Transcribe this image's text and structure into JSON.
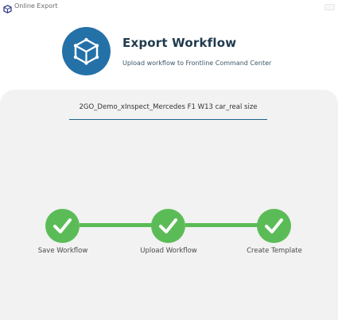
{
  "window": {
    "title": "Online Export"
  },
  "header": {
    "title": "Export Workflow",
    "subtitle": "Upload workflow to Frontline Command Center",
    "logo_icon": "cube-icon",
    "logo_color": "#2471a8"
  },
  "workflow": {
    "name": "2GO_Demo_xInspect_Mercedes F1 W13 car_real size"
  },
  "steps": [
    {
      "label": "Save Workflow",
      "status": "complete",
      "icon": "checkmark-icon"
    },
    {
      "label": "Upload Workflow",
      "status": "complete",
      "icon": "checkmark-icon"
    },
    {
      "label": "Create Template",
      "status": "complete",
      "icon": "checkmark-icon"
    }
  ],
  "colors": {
    "step_complete": "#5bbc57",
    "panel_background": "#f2f2f2",
    "accent_underline": "#1b5e8c"
  }
}
